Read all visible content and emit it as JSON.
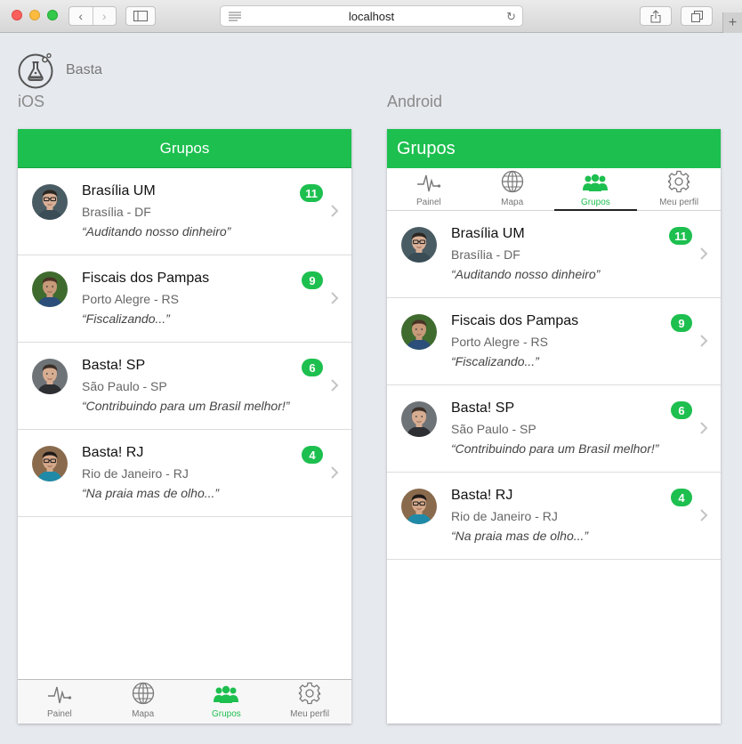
{
  "browser": {
    "url": "localhost"
  },
  "page": {
    "app_name": "Basta",
    "ios_label": "iOS",
    "android_label": "Android"
  },
  "screen_title": "Grupos",
  "tabs": [
    {
      "label": "Painel",
      "icon": "pulse-icon"
    },
    {
      "label": "Mapa",
      "icon": "globe-icon"
    },
    {
      "label": "Grupos",
      "icon": "people-icon"
    },
    {
      "label": "Meu perfil",
      "icon": "gear-icon"
    }
  ],
  "active_tab": "Grupos",
  "groups": [
    {
      "name": "Brasília UM",
      "city": "Brasília - DF",
      "motto": "“Auditando nosso dinheiro”",
      "count": "11"
    },
    {
      "name": "Fiscais dos Pampas",
      "city": "Porto Alegre - RS",
      "motto": "“Fiscalizando...”",
      "count": "9"
    },
    {
      "name": "Basta! SP",
      "city": "São Paulo - SP",
      "motto": "“Contribuindo para um Brasil melhor!”",
      "count": "6"
    },
    {
      "name": "Basta! RJ",
      "city": "Rio de Janeiro - RJ",
      "motto": "“Na praia mas de olho...”",
      "count": "4"
    }
  ],
  "colors": {
    "brand_green": "#1dbf4f",
    "divider": "#dcdcdc"
  }
}
